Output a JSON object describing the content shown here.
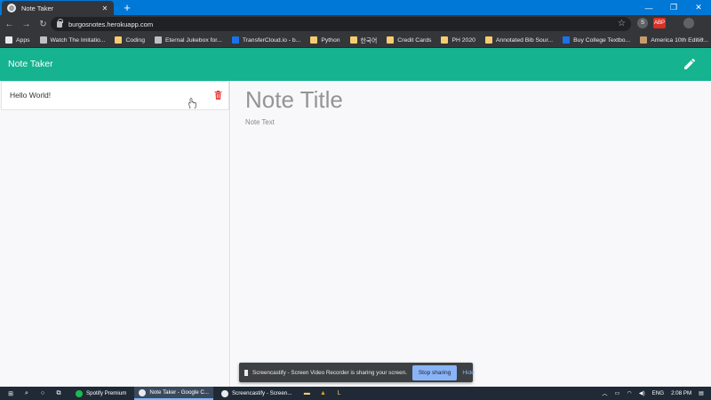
{
  "browser": {
    "tab_title": "Note Taker",
    "url": "burgosnotes.herokuapp.com",
    "bookmarks": [
      {
        "label": "Apps",
        "icon": "apps-grid-icon",
        "color": "#e8eaed"
      },
      {
        "label": "Watch The Imitatio...",
        "icon": "video-site-icon",
        "color": "#bdc1c6"
      },
      {
        "label": "Coding",
        "icon": "folder-icon",
        "color": "#f4cd6f"
      },
      {
        "label": "Eternal Jukebox for...",
        "icon": "globe-icon",
        "color": "#bdc1c6"
      },
      {
        "label": "TransferCloud.io - b...",
        "icon": "cloud-icon",
        "color": "#1a73e8"
      },
      {
        "label": "Python",
        "icon": "folder-icon",
        "color": "#f4cd6f"
      },
      {
        "label": "한국어",
        "icon": "folder-icon",
        "color": "#f4cd6f"
      },
      {
        "label": "Credit Cards",
        "icon": "folder-icon",
        "color": "#f4cd6f"
      },
      {
        "label": "PH 2020",
        "icon": "folder-icon",
        "color": "#f4cd6f"
      },
      {
        "label": "Annotated Bib Sour...",
        "icon": "folder-icon",
        "color": "#f4cd6f"
      },
      {
        "label": "Buy College Textbo...",
        "icon": "v-site-icon",
        "color": "#1a73e8"
      },
      {
        "label": "America 10th Editio...",
        "icon": "book-site-icon",
        "color": "#c89b6d"
      }
    ],
    "extensions": [
      {
        "name": "s-extension-icon",
        "color": "#5f6368",
        "text": "S"
      },
      {
        "name": "adblock-extension-icon",
        "color": "#d93025",
        "text": "ABP"
      },
      {
        "name": "puzzle-extension-icon",
        "color": "#35363a",
        "text": ""
      },
      {
        "name": "globe-extension-icon",
        "color": "#5f6368",
        "text": ""
      }
    ]
  },
  "app": {
    "brand": "Note Taker",
    "accent": "#15b38f",
    "notes": [
      {
        "title": "Hello World!"
      }
    ],
    "note_title_placeholder": "Note Title",
    "note_text_placeholder": "Note Text"
  },
  "screen_share": {
    "message": "Screencastify - Screen Video Recorder is sharing your screen.",
    "stop_label": "Stop sharing",
    "hide_label": "Hide"
  },
  "taskbar": {
    "apps": [
      {
        "label": "Spotify Premium",
        "color": "#1db954",
        "active": false
      },
      {
        "label": "Note Taker - Google C...",
        "color": "#e8eaed",
        "active": true
      },
      {
        "label": "Screencastify - Screen...",
        "color": "#e8eaed",
        "active": false
      }
    ],
    "language": "ENG",
    "time": "2:08 PM"
  }
}
